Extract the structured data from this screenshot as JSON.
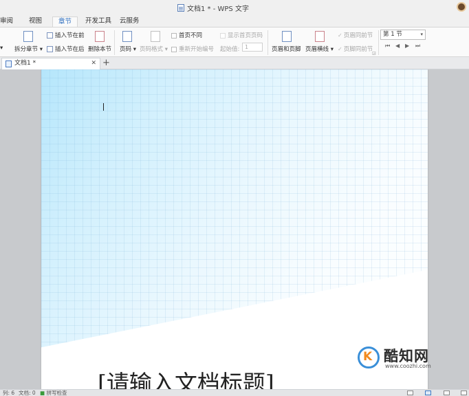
{
  "window": {
    "title": "文档1 * - WPS 文字"
  },
  "menu": {
    "tabs": [
      {
        "label": "审阅"
      },
      {
        "label": "视图"
      },
      {
        "label": "章节",
        "active": true
      },
      {
        "label": "开发工具"
      },
      {
        "label": "云服务"
      }
    ]
  },
  "ribbon": {
    "split_section": "拆分章节",
    "insert_before": "插入节在前",
    "insert_after": "插入节在后",
    "delete_section": "删除本节",
    "page_number": "页码",
    "page_number_format": "页码格式",
    "first_page_different": "首页不同",
    "restart_numbering": "重新开始编号",
    "show_first_page_number": "显示首页页码",
    "start_value_label": "起始值:",
    "start_value": "1",
    "header_footer": "页眉和页脚",
    "header_line": "页眉横线",
    "header_same_as_prev": "页眉同前节",
    "footer_same_as_prev": "页脚同前节",
    "section_select": "第 1 节"
  },
  "doc_tab": {
    "label": "文档1 *"
  },
  "document": {
    "title_placeholder": "[请输入文档标题]"
  },
  "watermark": {
    "name": "酷知网",
    "url": "www.coozhi.com"
  },
  "status": {
    "column": "列: 6",
    "word_count": "文档: 0",
    "spell_check": "拼写检查"
  }
}
